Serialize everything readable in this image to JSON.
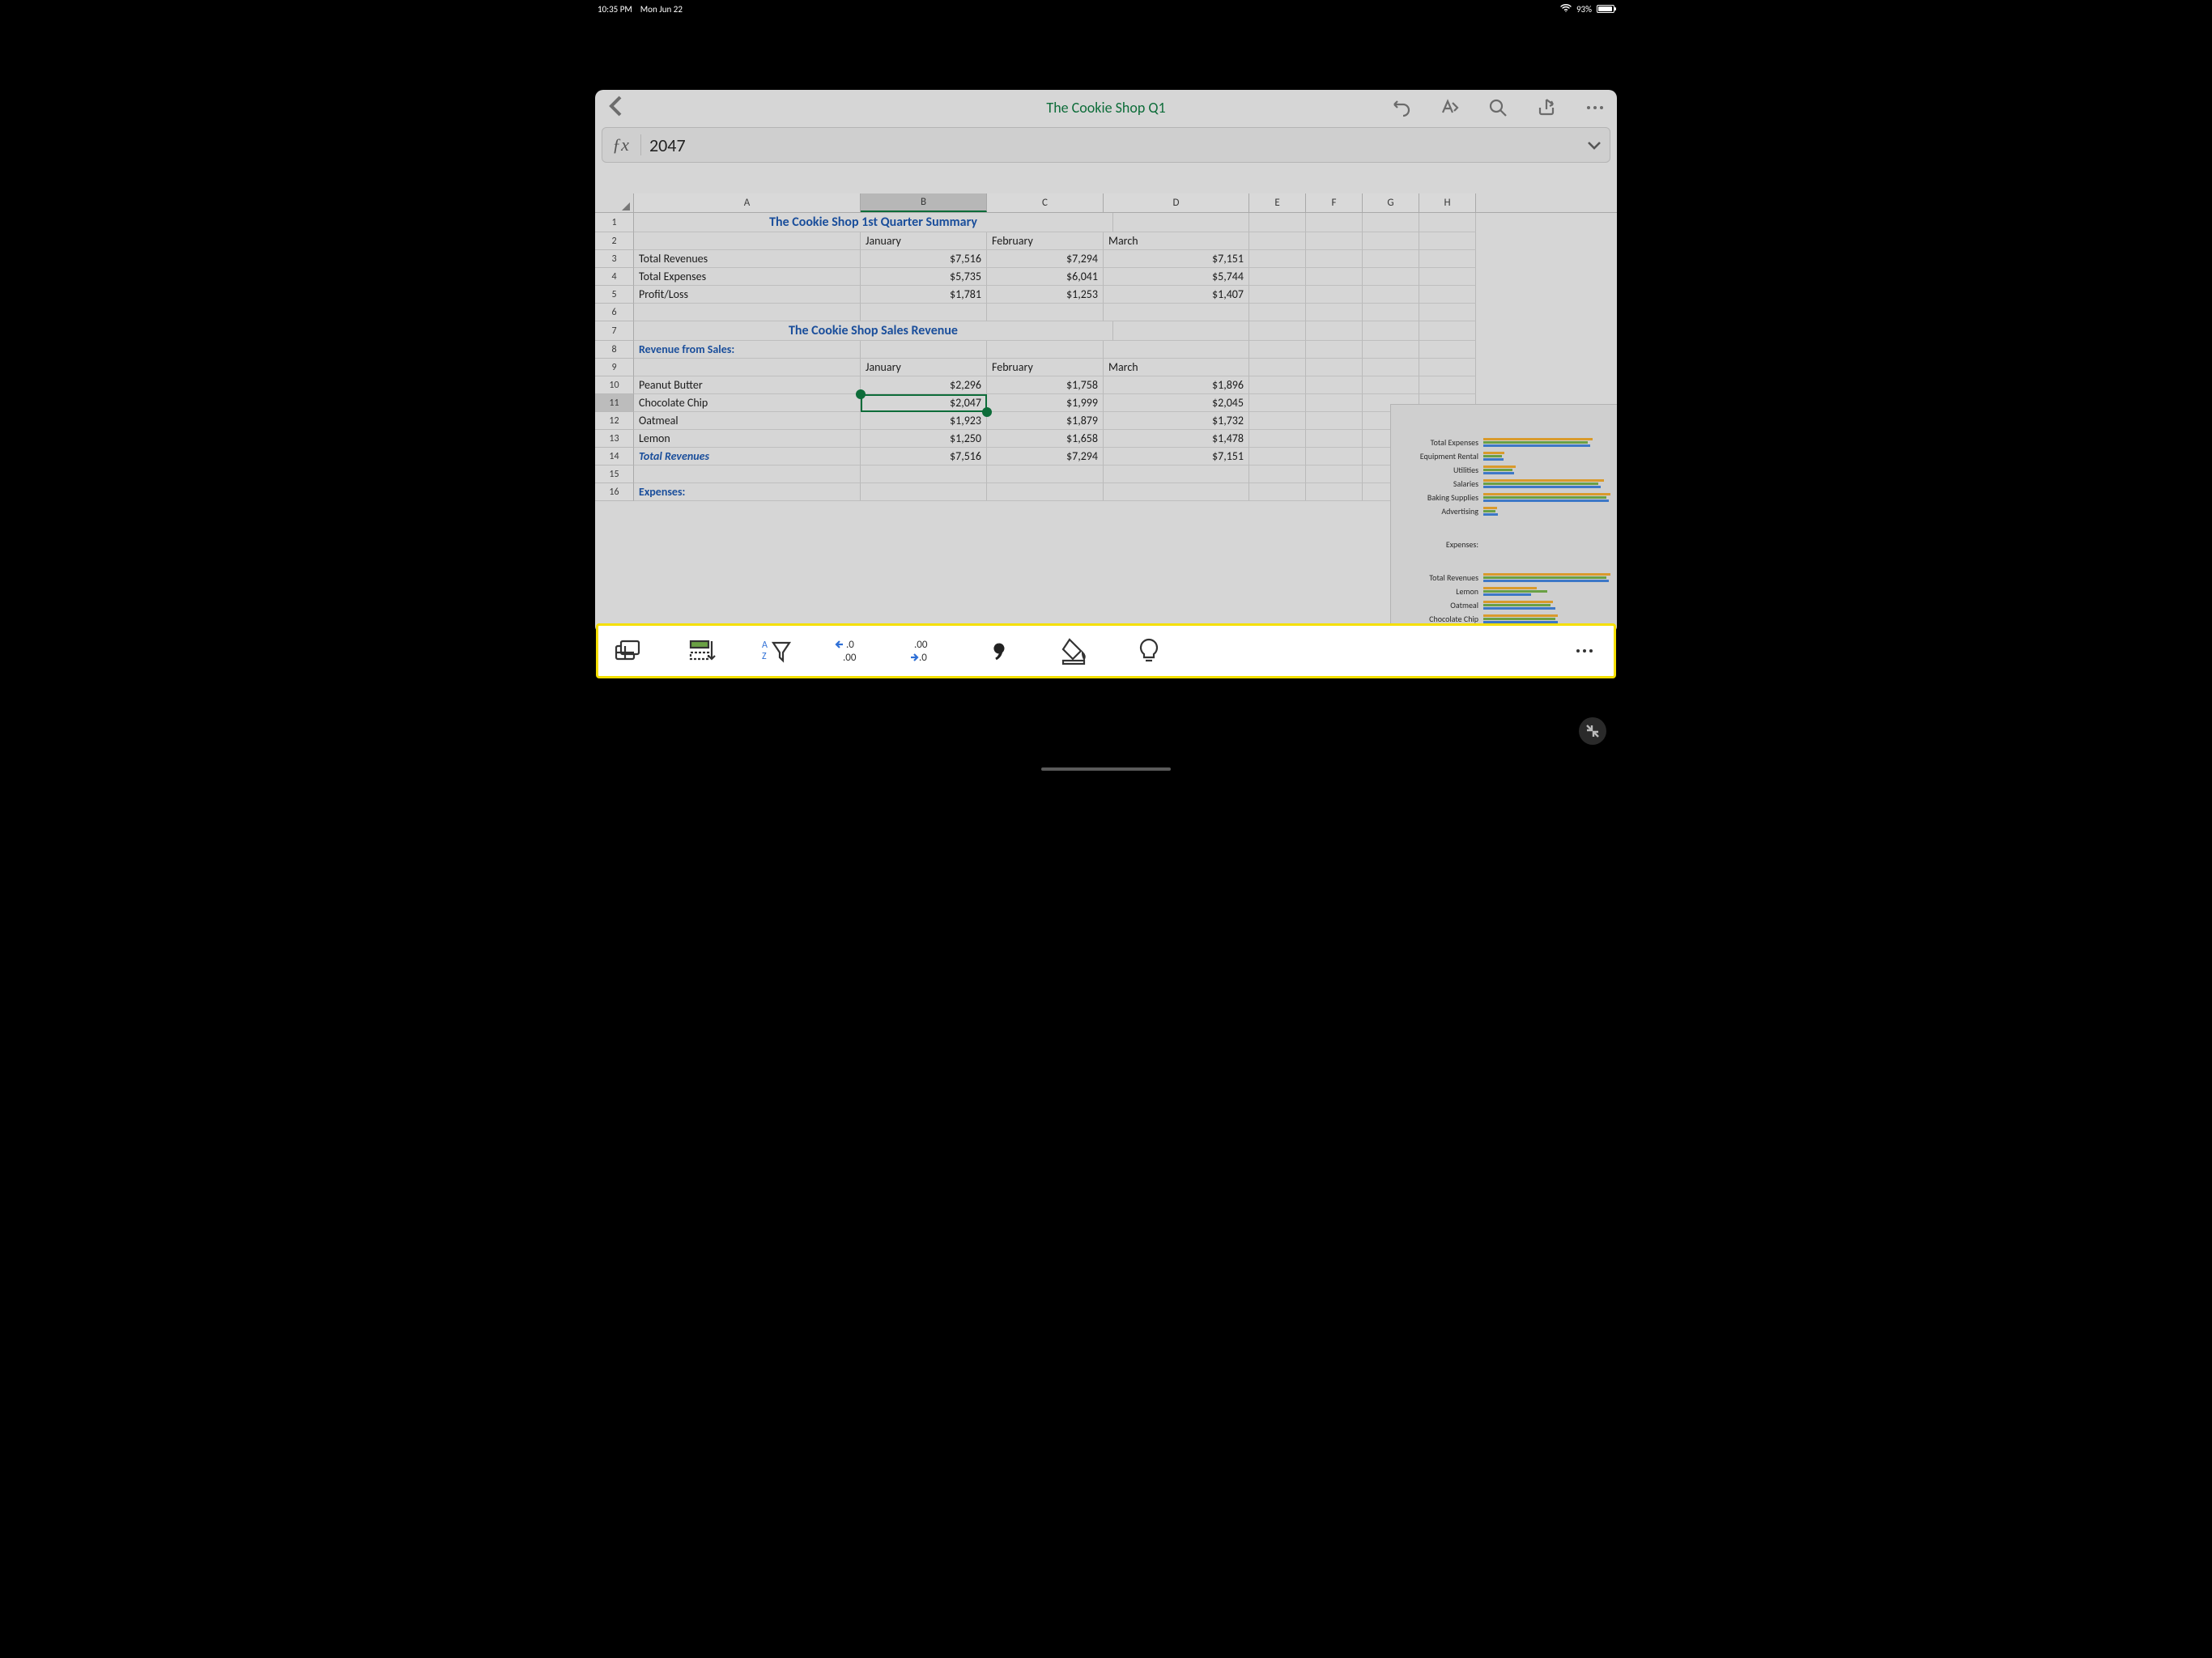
{
  "statusbar": {
    "time": "10:35 PM",
    "date": "Mon Jun 22",
    "battery_pct": "93%"
  },
  "app": {
    "title": "The Cookie Shop Q1",
    "formula_value": "2047"
  },
  "columns": [
    "A",
    "B",
    "C",
    "D",
    "E",
    "F",
    "G",
    "H"
  ],
  "selected_col": "B",
  "selected_row": 11,
  "sheet": {
    "heading1": "The Cookie Shop 1st Quarter Summary",
    "heading2": "The Cookie Shop Sales Revenue",
    "months": {
      "jan": "January",
      "feb": "February",
      "mar": "March"
    },
    "summary_rows": {
      "revenues_label": "Total Revenues",
      "expenses_label": "Total Expenses",
      "profit_label": "Profit/Loss",
      "revenues": {
        "jan": "$7,516",
        "feb": "$7,294",
        "mar": "$7,151"
      },
      "expenses": {
        "jan": "$5,735",
        "feb": "$6,041",
        "mar": "$5,744"
      },
      "profit": {
        "jan": "$1,781",
        "feb": "$1,253",
        "mar": "$1,407"
      }
    },
    "revenue_section_label": "Revenue from Sales:",
    "products": {
      "pb": {
        "label": "Peanut Butter",
        "jan": "$2,296",
        "feb": "$1,758",
        "mar": "$1,896"
      },
      "cc": {
        "label": "Chocolate Chip",
        "jan": "$2,047",
        "feb": "$1,999",
        "mar": "$2,045"
      },
      "oa": {
        "label": "Oatmeal",
        "jan": "$1,923",
        "feb": "$1,879",
        "mar": "$1,732"
      },
      "le": {
        "label": "Lemon",
        "jan": "$1,250",
        "feb": "$1,658",
        "mar": "$1,478"
      }
    },
    "total_revenues_label": "Total Revenues",
    "total_revenues": {
      "jan": "$7,516",
      "feb": "$7,294",
      "mar": "$7,151"
    },
    "expenses_section_label": "Expenses:"
  },
  "chart": {
    "group1_title": "Expenses:",
    "labels1": [
      "Total Expenses",
      "Equipment Rental",
      "Utilities",
      "Salaries",
      "Baking Supplies",
      "Advertising"
    ],
    "group2_labels": [
      "Total Revenues",
      "Lemon",
      "Oatmeal",
      "Chocolate Chip"
    ]
  },
  "toolbar_icons": [
    "card-view",
    "insert-row",
    "sort-filter",
    "decrease-decimal",
    "increase-decimal",
    "comma-style",
    "fill-color",
    "ideas",
    "more"
  ]
}
